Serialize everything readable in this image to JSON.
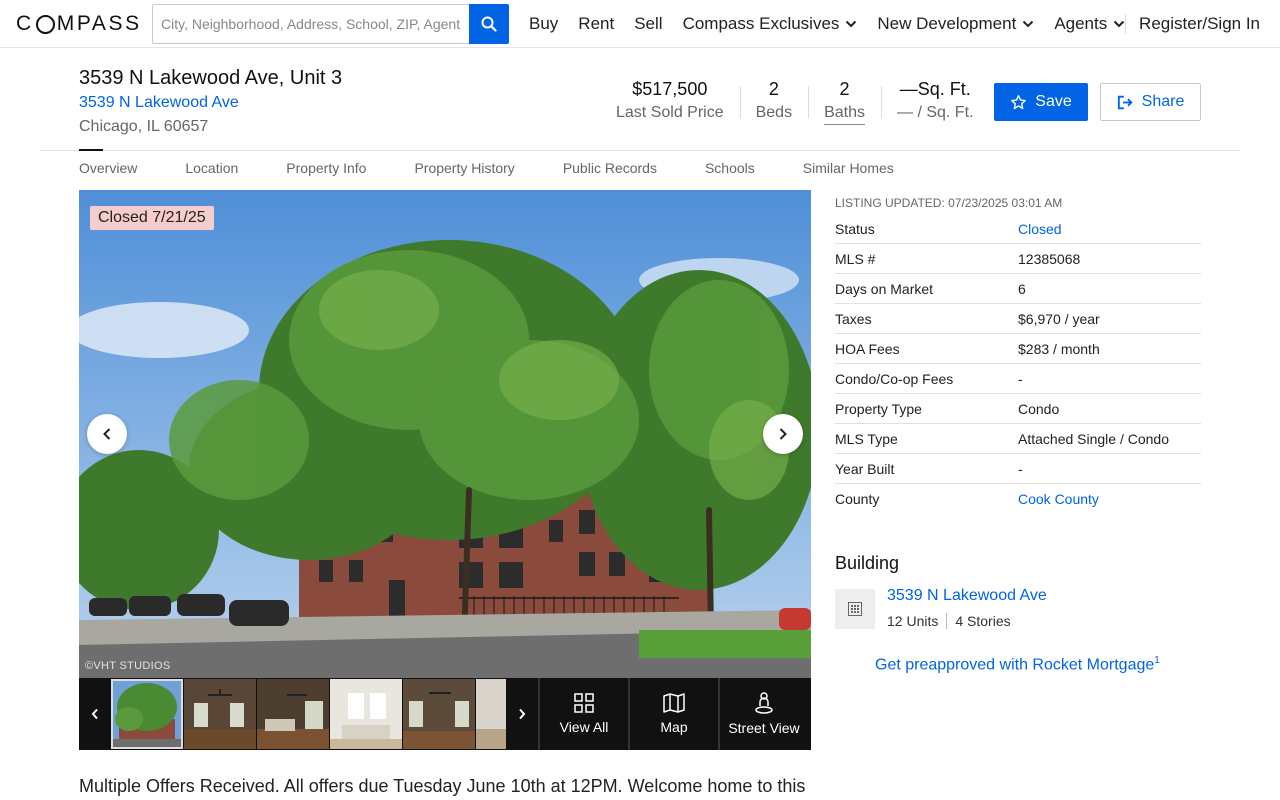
{
  "nav": {
    "logo_left": "C",
    "logo_right": "MPASS",
    "search_placeholder": "City, Neighborhood, Address, School, ZIP, Agent",
    "links": [
      "Buy",
      "Rent",
      "Sell",
      "Compass Exclusives",
      "New Development",
      "Agents"
    ],
    "signin": "Register/Sign In"
  },
  "header": {
    "title": "3539 N Lakewood Ave, Unit 3",
    "building_link": "3539 N Lakewood Ave",
    "city": "Chicago, IL 60657",
    "stats": [
      {
        "value": "$517,500",
        "label": "Last Sold Price"
      },
      {
        "value": "2",
        "label": "Beds"
      },
      {
        "value": "2",
        "label": "Baths"
      },
      {
        "value": "—Sq. Ft.",
        "label": "— / Sq. Ft."
      }
    ],
    "save": "Save",
    "share": "Share"
  },
  "tabs": [
    "Overview",
    "Location",
    "Property Info",
    "Property History",
    "Public Records",
    "Schools",
    "Similar Homes"
  ],
  "photo": {
    "badge": "Closed 7/21/25",
    "watermark": "©VHT STUDIOS",
    "tiles": [
      "View All",
      "Map",
      "Street View"
    ]
  },
  "description": "Multiple Offers Received. All offers due Tuesday June 10th at 12PM. Welcome home to this",
  "details": {
    "updated": "LISTING UPDATED: 07/23/2025 03:01 AM",
    "rows": [
      {
        "k": "Status",
        "v": "Closed"
      },
      {
        "k": "MLS #",
        "v": "12385068"
      },
      {
        "k": "Days on Market",
        "v": "6"
      },
      {
        "k": "Taxes",
        "v": "$6,970 / year"
      },
      {
        "k": "HOA Fees",
        "v": "$283 / month"
      },
      {
        "k": "Condo/Co-op Fees",
        "v": "-"
      },
      {
        "k": "Property Type",
        "v": "Condo"
      },
      {
        "k": "MLS Type",
        "v": "Attached Single / Condo"
      },
      {
        "k": "Year Built",
        "v": "-"
      },
      {
        "k": "County",
        "v": "Cook County"
      }
    ]
  },
  "building": {
    "heading": "Building",
    "name": "3539 N Lakewood Ave",
    "units": "12 Units",
    "stories": "4 Stories"
  },
  "mortgage": {
    "text": "Get preapproved with Rocket Mortgage",
    "sup": "1"
  },
  "colors": {
    "brand_blue": "#0064e5",
    "badge_bg": "#f7cccc"
  }
}
